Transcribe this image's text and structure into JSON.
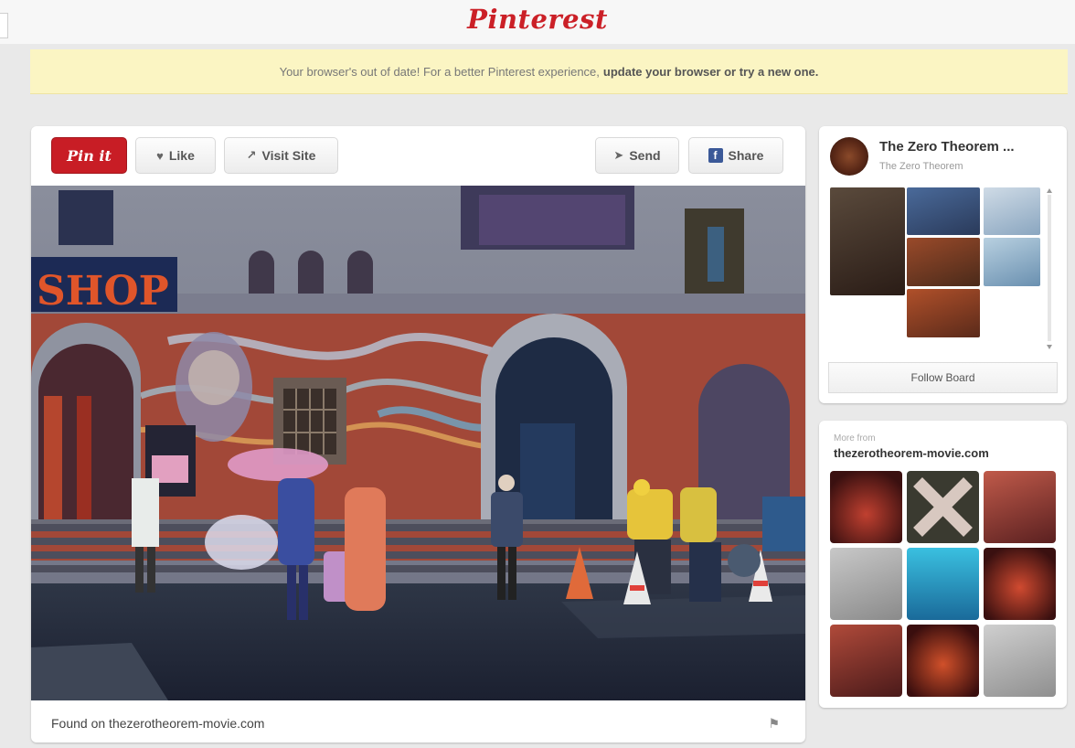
{
  "header": {
    "logo": "Pinterest"
  },
  "banner": {
    "text": "Your browser's out of date! For a better Pinterest experience,",
    "link": "update your browser or try a new one."
  },
  "pin": {
    "pin_it_label": "Pin it",
    "like_label": "Like",
    "visit_label": "Visit Site",
    "send_label": "Send",
    "share_label": "Share",
    "photo_sign": "SHOP",
    "found_on": "Found on thezerotheorem-movie.com"
  },
  "board": {
    "title": "The Zero Theorem ...",
    "subtitle": "The Zero Theorem",
    "follow_label": "Follow Board"
  },
  "more": {
    "label": "More from",
    "site": "thezerotheorem-movie.com"
  },
  "colors": {
    "brand": "#cb2027",
    "banner": "#fbf5c3"
  }
}
